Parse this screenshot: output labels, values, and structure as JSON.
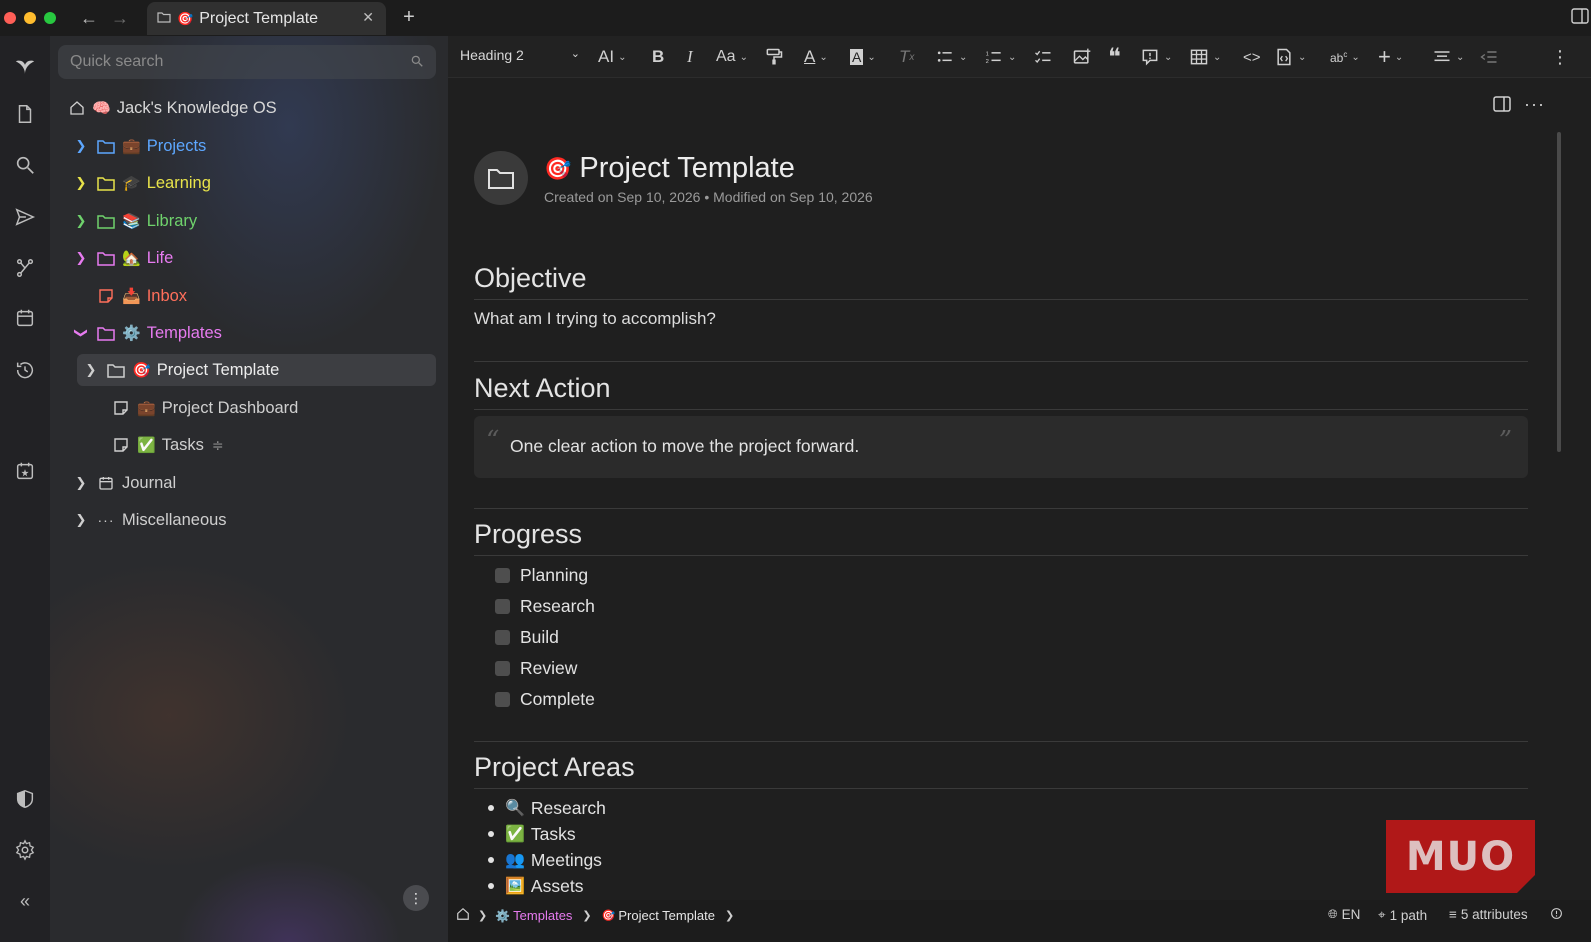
{
  "colors": {
    "projects": "#5da7ff",
    "learning": "#e8e34a",
    "library": "#6fd26c",
    "life": "#e77bf0",
    "inbox": "#ff6f5b",
    "templates": "#e77bf0",
    "default": "#cfcfcf",
    "accent": "#e77bf0"
  },
  "tab": {
    "title": "Project Template",
    "emoji": "🎯"
  },
  "search": {
    "placeholder": "Quick search"
  },
  "tree": {
    "root": {
      "emoji": "🧠",
      "label": "Jack's Knowledge OS"
    },
    "items": [
      {
        "emoji": "💼",
        "label": "Projects"
      },
      {
        "emoji": "🎓",
        "label": "Learning"
      },
      {
        "emoji": "📚",
        "label": "Library"
      },
      {
        "emoji": "🏡",
        "label": "Life"
      },
      {
        "emoji": "📥",
        "label": "Inbox"
      },
      {
        "emoji": "⚙️",
        "label": "Templates"
      },
      {
        "emoji": "🎯",
        "label": "Project Template"
      },
      {
        "emoji": "💼",
        "label": "Project Dashboard"
      },
      {
        "emoji": "✅",
        "label": "Tasks"
      },
      {
        "emoji": "",
        "label": "Journal"
      },
      {
        "emoji": "",
        "label": "Miscellaneous"
      }
    ]
  },
  "toolbar": {
    "heading_select": "Heading 2"
  },
  "note": {
    "title": "Project Template",
    "title_emoji": "🎯",
    "meta": "Created on Sep 10, 2026 • Modified on Sep 10, 2026",
    "sections": {
      "objective": {
        "heading": "Objective",
        "text": "What am I trying to accomplish?"
      },
      "next_action": {
        "heading": "Next Action",
        "quote": "One clear action to move the project forward."
      },
      "progress": {
        "heading": "Progress",
        "items": [
          "Planning",
          "Research",
          "Build",
          "Review",
          "Complete"
        ]
      },
      "areas": {
        "heading": "Project Areas",
        "items": [
          {
            "emoji": "🔍",
            "label": "Research"
          },
          {
            "emoji": "✅",
            "label": "Tasks"
          },
          {
            "emoji": "👥",
            "label": "Meetings"
          },
          {
            "emoji": "🖼️",
            "label": "Assets"
          }
        ]
      }
    }
  },
  "watermark": {
    "text": "MUO"
  },
  "statusbar": {
    "crumb_templates_emoji": "⚙️",
    "crumb_templates": "Templates",
    "crumb_note_emoji": "🎯",
    "crumb_note": "Project Template",
    "language": "EN",
    "paths": "1 path",
    "attributes": "5 attributes"
  }
}
